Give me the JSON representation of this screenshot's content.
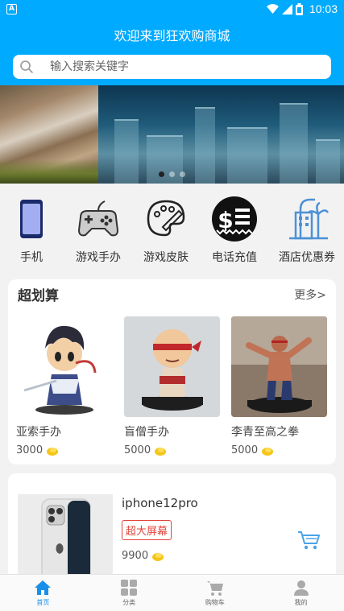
{
  "status_bar": {
    "time": "10:03",
    "app_badge": "A"
  },
  "header": {
    "title": "欢迎来到狂欢购商城",
    "search_placeholder": "输入搜索关键字"
  },
  "banner": {
    "slide_count": 3,
    "active_slide": 0
  },
  "categories": [
    {
      "label": "手机",
      "icon": "phone-icon"
    },
    {
      "label": "游戏手办",
      "icon": "gamepad-icon"
    },
    {
      "label": "游戏皮肤",
      "icon": "palette-icon"
    },
    {
      "label": "电话充值",
      "icon": "dollar-icon"
    },
    {
      "label": "酒店优惠券",
      "icon": "hotel-icon"
    }
  ],
  "deals": {
    "title": "超划算",
    "more": "更多>",
    "products": [
      {
        "name": "亚索手办",
        "price": "3000"
      },
      {
        "name": "盲僧手办",
        "price": "5000"
      },
      {
        "name": "李青至高之拳",
        "price": "5000"
      }
    ]
  },
  "list_item": {
    "name": "iphone12pro",
    "tag": "超大屏幕",
    "price": "9900"
  },
  "tabs": [
    {
      "label": "首页",
      "icon": "home-icon",
      "active": true
    },
    {
      "label": "分类",
      "icon": "grid-icon",
      "active": false
    },
    {
      "label": "购物车",
      "icon": "cart-icon",
      "active": false
    },
    {
      "label": "我的",
      "icon": "user-icon",
      "active": false
    }
  ],
  "colors": {
    "primary": "#00aaff",
    "accent": "#1a8ee8",
    "tag_red": "#e0443a",
    "coin": "#f5c518"
  }
}
